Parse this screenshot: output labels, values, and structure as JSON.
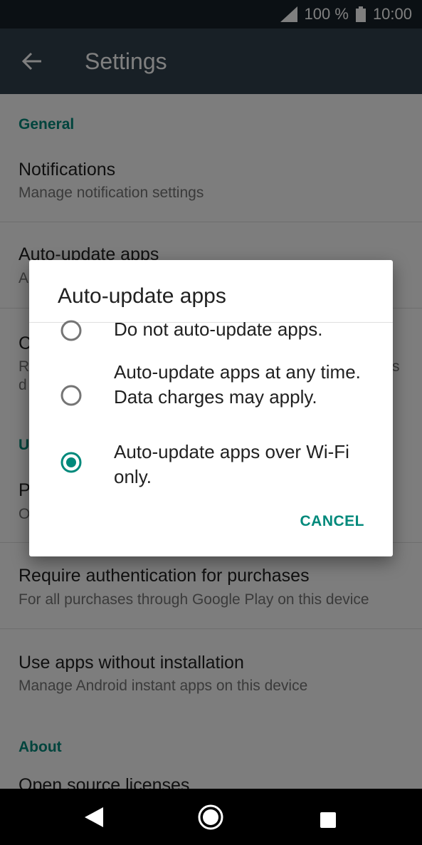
{
  "status_bar": {
    "battery": "100 %",
    "time": "10:00"
  },
  "app_bar": {
    "title": "Settings"
  },
  "settings": {
    "general_header": "General",
    "notifications": {
      "title": "Notifications",
      "subtitle": "Manage notification settings"
    },
    "auto_update": {
      "title": "Auto-update apps",
      "subtitle": "A"
    },
    "partial_item_1": {
      "title": "C",
      "subtitle_line1": "R",
      "subtitle_line2": "d",
      "subtitle_tail": "s"
    },
    "partial_header": "U",
    "partial_item_2": {
      "title": "P",
      "subtitle": "O"
    },
    "require_auth": {
      "title": "Require authentication for purchases",
      "subtitle": "For all purchases through Google Play on this device"
    },
    "instant_apps": {
      "title": "Use apps without installation",
      "subtitle": "Manage Android instant apps on this device"
    },
    "about_header": "About",
    "open_source": {
      "title": "Open source licenses"
    }
  },
  "dialog": {
    "title": "Auto-update apps",
    "options": [
      {
        "label": "Do not auto-update apps.",
        "selected": false
      },
      {
        "label": "Auto-update apps at any time. Data charges may apply.",
        "selected": false
      },
      {
        "label": "Auto-update apps over Wi-Fi only.",
        "selected": true
      }
    ],
    "cancel_label": "CANCEL"
  },
  "colors": {
    "accent": "#00897b",
    "status_bar": "#162129",
    "app_bar": "#30414d"
  },
  "icons": [
    "signal-icon",
    "battery-icon",
    "back-arrow-icon",
    "nav-back-icon",
    "nav-home-icon",
    "nav-recents-icon"
  ]
}
